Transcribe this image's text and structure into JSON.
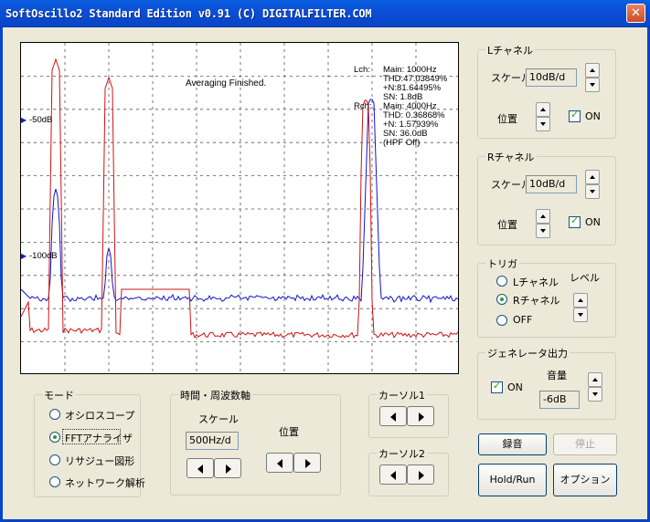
{
  "window": {
    "title": "SoftOscillo2 Standard Edition v0.91 (C) DIGITALFILTER.COM"
  },
  "scope": {
    "averaging_text": "Averaging Finished.",
    "marker_50": "-50dB",
    "marker_100": "-100dB",
    "lch_label": "Lch:",
    "lch_info": [
      "Main: 1000Hz",
      "THD:47.03849%",
      "+N:81.64495%",
      "SN:  1.8dB"
    ],
    "rch_label": "Rch:",
    "rch_info": [
      "Main: 4000Hz",
      "THD: 0.36868%",
      "+N: 1.57939%",
      "SN:  36.0dB",
      "(HPF Off)"
    ],
    "colors": {
      "lch": "#cc1414",
      "rch": "#1414cc",
      "grid": "#555555"
    }
  },
  "lch": {
    "title": "Lチャネル",
    "scale_label": "スケール",
    "scale_value": "10dB/d",
    "pos_label": "位置",
    "on_label": "ON",
    "on_checked": true
  },
  "rch": {
    "title": "Rチャネル",
    "scale_label": "スケール",
    "scale_value": "10dB/d",
    "pos_label": "位置",
    "on_label": "ON",
    "on_checked": true
  },
  "trigger": {
    "title": "トリガ",
    "options": [
      "Lチャネル",
      "Rチャネル",
      "OFF"
    ],
    "selected": 1,
    "level_label": "レベル"
  },
  "generator": {
    "title": "ジェネレータ出力",
    "on_label": "ON",
    "on_checked": true,
    "volume_label": "音量",
    "volume_value": "-6dB"
  },
  "mode": {
    "title": "モード",
    "options": [
      "オシロスコープ",
      "FFTアナライザ",
      "リサジュー図形",
      "ネットワーク解析"
    ],
    "selected": 1
  },
  "timefreq": {
    "title": "時間・周波数軸",
    "scale_label": "スケール",
    "scale_value": "500Hz/d",
    "pos_label": "位置"
  },
  "cursor1": {
    "title": "カーソル1"
  },
  "cursor2": {
    "title": "カーソル2"
  },
  "buttons": {
    "record": "録音",
    "stop": "停止",
    "holdrun": "Hold/Run",
    "options": "オプション"
  }
}
